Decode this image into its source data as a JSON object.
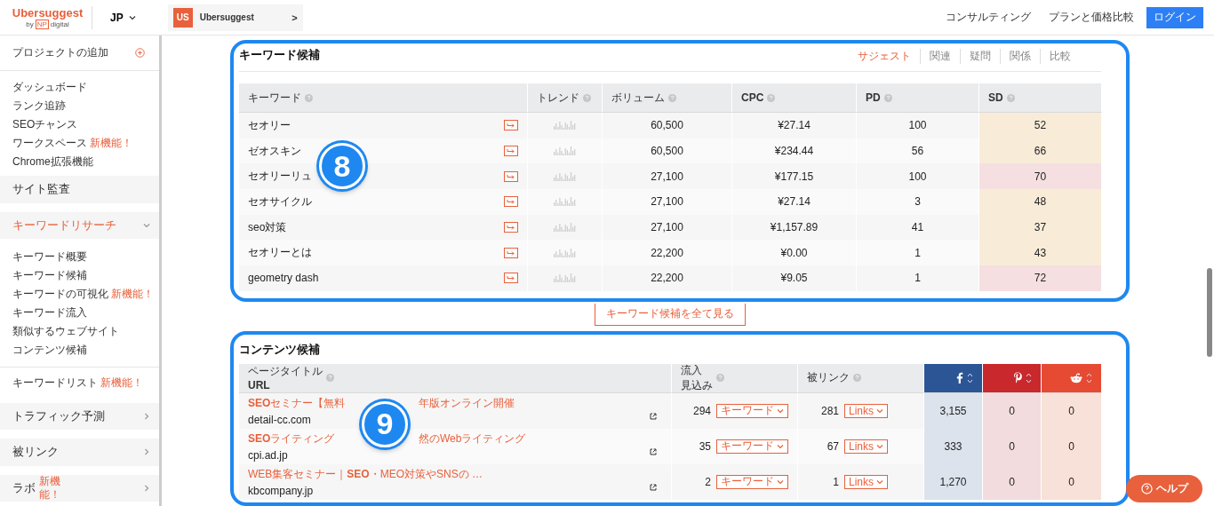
{
  "header": {
    "logo": "Ubersuggest",
    "logo_by": "by",
    "logo_np": "NP",
    "logo_digital": "digital",
    "country": "JP",
    "project": {
      "badge": "US",
      "name": "Ubersuggest",
      "arrow": ">"
    },
    "nav": [
      "コンサルティング",
      "プランと価格比較"
    ],
    "login": "ログイン"
  },
  "sidebar": {
    "add_project": "プロジェクトの追加",
    "items": [
      {
        "kind": "link",
        "label": "ダッシュボード"
      },
      {
        "kind": "link",
        "label": "ランク追跡"
      },
      {
        "kind": "link",
        "label": "SEOチャンス"
      },
      {
        "kind": "link",
        "label": "ワークスペース",
        "badge": "新機能！"
      },
      {
        "kind": "link",
        "label": "Chrome拡張機能"
      },
      {
        "kind": "section",
        "label": "サイト監査"
      },
      {
        "kind": "section",
        "label": "キーワードリサーチ",
        "expanded": true
      },
      {
        "kind": "link",
        "label": "キーワード概要"
      },
      {
        "kind": "link",
        "label": "キーワード候補"
      },
      {
        "kind": "link",
        "label": "キーワードの可視化",
        "badge": "新機能！"
      },
      {
        "kind": "link",
        "label": "キーワード流入"
      },
      {
        "kind": "link",
        "label": "類似するウェブサイト"
      },
      {
        "kind": "link",
        "label": "コンテンツ候補"
      },
      {
        "kind": "divider_link",
        "label": "キーワードリスト",
        "badge": "新機能！"
      },
      {
        "kind": "section",
        "label": "トラフィック予測",
        "expanded": false
      },
      {
        "kind": "section",
        "label": "被リンク",
        "expanded": false
      },
      {
        "kind": "section",
        "label": "ラボ",
        "badge": "新機能！",
        "expanded": false
      }
    ]
  },
  "keyword_card": {
    "title": "キーワード候補",
    "marker": "8",
    "tabs": [
      {
        "label": "サジェスト",
        "selected": true
      },
      {
        "label": "関連",
        "selected": false
      },
      {
        "label": "疑問",
        "selected": false
      },
      {
        "label": "関係",
        "selected": false
      },
      {
        "label": "比較",
        "selected": false
      }
    ],
    "columns": [
      "キーワード",
      "トレンド",
      "ボリューム",
      "CPC",
      "PD",
      "SD"
    ],
    "rows": [
      {
        "keyword": "セオリー",
        "volume": "60,500",
        "cpc": "¥27.14",
        "pd": "100",
        "sd": "52",
        "color": "#f8ecd9"
      },
      {
        "keyword": "ゼオスキン",
        "volume": "60,500",
        "cpc": "¥234.44",
        "pd": "56",
        "sd": "66",
        "color": "#f8ecd9"
      },
      {
        "keyword": "セオリーリュ",
        "volume": "27,100",
        "cpc": "¥177.15",
        "pd": "100",
        "sd": "70",
        "color": "#f5dfe0"
      },
      {
        "keyword": "セオサイクル",
        "volume": "27,100",
        "cpc": "¥27.14",
        "pd": "3",
        "sd": "48",
        "color": "#f8ecd9"
      },
      {
        "keyword": "seo対策",
        "volume": "27,100",
        "cpc": "¥1,157.89",
        "pd": "41",
        "sd": "37",
        "color": "#f8ecd9"
      },
      {
        "keyword": "セオリーとは",
        "volume": "22,200",
        "cpc": "¥0.00",
        "pd": "1",
        "sd": "43",
        "color": "#f8ecd9"
      },
      {
        "keyword": "geometry dash",
        "volume": "22,200",
        "cpc": "¥9.05",
        "pd": "1",
        "sd": "72",
        "color": "#f5dfe0"
      }
    ],
    "view_all": "キーワード候補を全て見る"
  },
  "content_card": {
    "title": "コンテンツ候補",
    "marker": "9",
    "columns": {
      "title": "ページタイトル",
      "url": "URL",
      "traffic": [
        "流入",
        "見込み"
      ],
      "backlinks": "被リンク"
    },
    "rows": [
      {
        "title": [
          "**SEO**セミナー【無料",
          "年版オンライン開催"
        ],
        "url": "detail-cc.com",
        "traffic": "294",
        "keywords": "キーワード",
        "backlinks": "281",
        "links": "Links",
        "facebook": "3,155",
        "pinterest": "0",
        "reddit": "0"
      },
      {
        "title": [
          "**SEO**ライティング",
          "然のWebライティング"
        ],
        "url": "cpi.ad.jp",
        "traffic": "35",
        "keywords": "キーワード",
        "backlinks": "67",
        "links": "Links",
        "facebook": "333",
        "pinterest": "0",
        "reddit": "0"
      },
      {
        "title": [
          "WEB集客セミナー｜**SEO**・MEO対策やSNSの …"
        ],
        "url": "kbcompany.jp",
        "traffic": "2",
        "keywords": "キーワード",
        "backlinks": "1",
        "links": "Links",
        "facebook": "1,270",
        "pinterest": "0",
        "reddit": "0"
      }
    ]
  },
  "help": "ヘルプ"
}
